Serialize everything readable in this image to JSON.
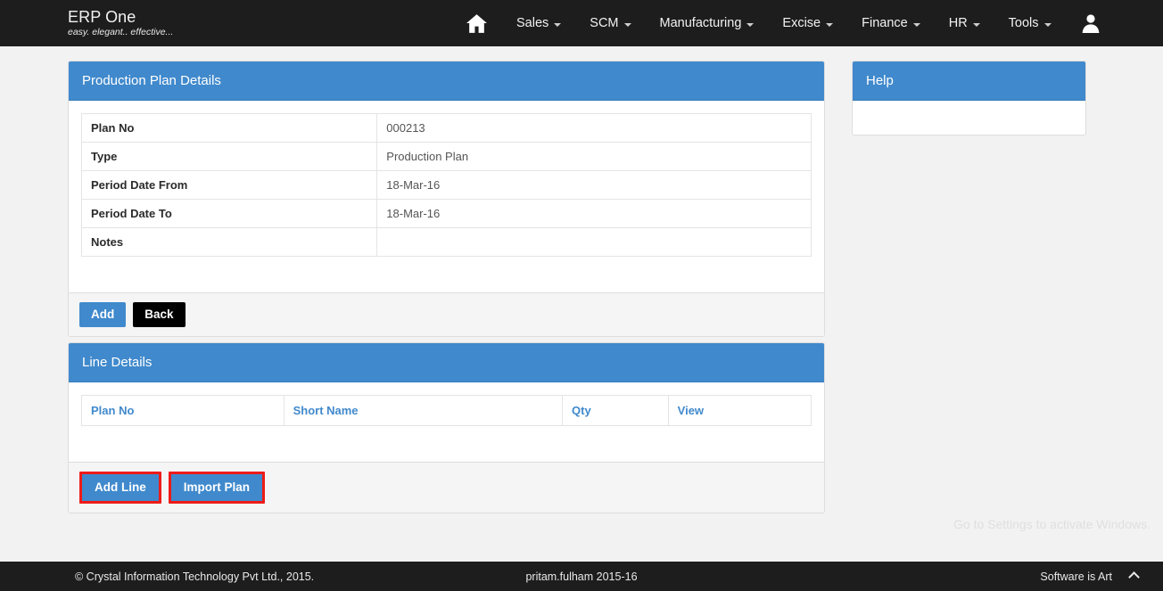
{
  "navbar": {
    "brand_title": "ERP One",
    "brand_tagline": "easy. elegant.. effective...",
    "home_icon": "home-icon",
    "user_icon": "user-avatar-icon",
    "menu": [
      {
        "label": "Sales"
      },
      {
        "label": "SCM"
      },
      {
        "label": "Manufacturing"
      },
      {
        "label": "Excise"
      },
      {
        "label": "Finance"
      },
      {
        "label": "HR"
      },
      {
        "label": "Tools"
      }
    ]
  },
  "plan_panel": {
    "title": "Production Plan Details",
    "rows": [
      {
        "label": "Plan No",
        "value": "000213"
      },
      {
        "label": "Type",
        "value": "Production Plan"
      },
      {
        "label": "Period Date From",
        "value": "18-Mar-16"
      },
      {
        "label": "Period Date To",
        "value": "18-Mar-16"
      },
      {
        "label": "Notes",
        "value": ""
      }
    ],
    "add_label": "Add",
    "back_label": "Back"
  },
  "help_panel": {
    "title": "Help",
    "body": ""
  },
  "line_panel": {
    "title": "Line Details",
    "columns": [
      "Plan No",
      "Short Name",
      "Qty",
      "View"
    ],
    "rows": [],
    "add_line_label": "Add Line",
    "import_plan_label": "Import Plan"
  },
  "watermark": {
    "text": "Go to Settings to activate Windows."
  },
  "footer": {
    "copyright": "© Crystal Information Technology Pvt Ltd., 2015.",
    "user": "pritam.fulham 2015-16",
    "tagline": "Software is Art",
    "chevron": "chevron-up-icon"
  },
  "colors": {
    "primary": "#4089cc",
    "dark": "#1d1d1d",
    "highlight": "#ee1b17",
    "page_bg": "#f2f2f2"
  }
}
